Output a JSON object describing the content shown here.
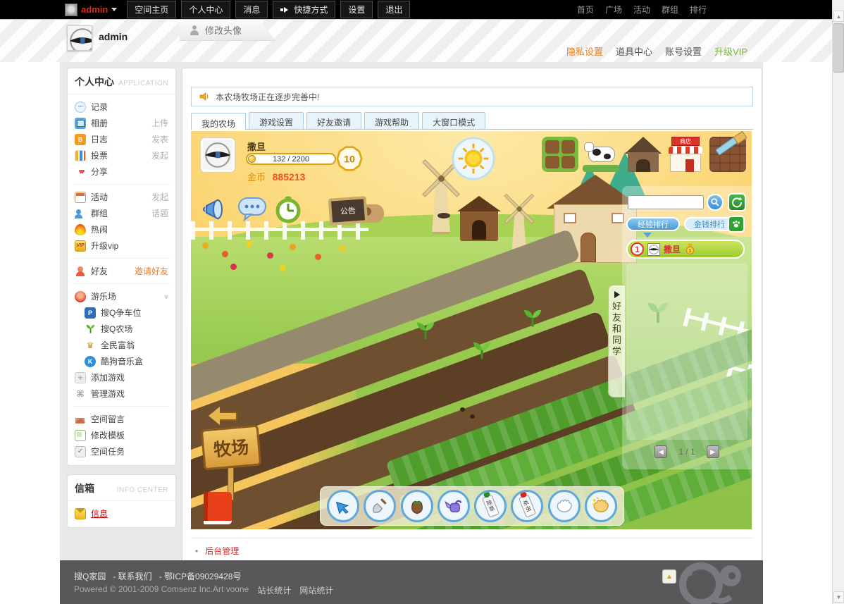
{
  "topbar": {
    "user": "admin",
    "menu": [
      "空间主页",
      "个人中心",
      "消息",
      "快捷方式",
      "设置",
      "退出"
    ],
    "right_links": [
      "首页",
      "广场",
      "活动",
      "群组",
      "排行"
    ]
  },
  "header": {
    "username": "admin",
    "edit_avatar": "修改头像",
    "links": [
      "隐私设置",
      "道具中心",
      "账号设置",
      "升级VIP"
    ]
  },
  "sidebar": {
    "profile": {
      "title": "个人中心",
      "subtitle": "APPLICATION",
      "items": [
        {
          "label": "记录",
          "action": ""
        },
        {
          "label": "相册",
          "action": "上传"
        },
        {
          "label": "日志",
          "action": "发表",
          "badge": "B"
        },
        {
          "label": "投票",
          "action": "发起"
        },
        {
          "label": "分享",
          "action": ""
        },
        {
          "label": "活动",
          "action": "发起"
        },
        {
          "label": "群组",
          "action": "话题"
        },
        {
          "label": "热闹",
          "action": ""
        },
        {
          "label": "升级vip",
          "action": "",
          "badge": "VIP"
        },
        {
          "label": "好友",
          "action": "邀请好友"
        },
        {
          "label": "游乐场",
          "action": ""
        },
        {
          "label": "搜Q争车位",
          "action": "",
          "badge": "P"
        },
        {
          "label": "搜Q农场",
          "action": ""
        },
        {
          "label": "全民富翁",
          "action": ""
        },
        {
          "label": "酷狗音乐盒",
          "action": "",
          "badge": "K"
        },
        {
          "label": "添加游戏",
          "action": ""
        },
        {
          "label": "管理游戏",
          "action": ""
        },
        {
          "label": "空间留言",
          "action": ""
        },
        {
          "label": "修改模板",
          "action": ""
        },
        {
          "label": "空间任务",
          "action": ""
        }
      ]
    },
    "inbox": {
      "title": "信箱",
      "subtitle": "INFO CENTER",
      "item": "信息"
    }
  },
  "main": {
    "announcement": "本农场牧场正在逐步完善中!",
    "tabs": [
      "我的农场",
      "游戏设置",
      "好友邀请",
      "游戏帮助",
      "大窗口模式"
    ],
    "admin_link": "后台管理"
  },
  "game": {
    "player": {
      "name": "撒旦",
      "xp": "132 / 2200",
      "level": "10",
      "coin_label": "金币",
      "coins": "885213"
    },
    "board": "公告",
    "shop_sign": "商店",
    "sign": "牧场",
    "friends_tab": "好友和同学",
    "rank": {
      "exp_tab": "经验排行",
      "money_tab": "金钱排行",
      "first_num": "1",
      "first_name": "撒旦",
      "medal": "1",
      "page": "1 / 1"
    },
    "tools": {
      "weed": "除草",
      "pest": "杀虫"
    }
  },
  "footer": {
    "site": "搜Q家园",
    "contact": "- 联系我们",
    "icp": "- 鄂ICP备09029428号",
    "powered": "Powered © 2001-2009 Comsenz Inc.Art voone",
    "stat1": "站长统计",
    "stat2": "网站统计"
  },
  "colors": {
    "admin_red": "#e8250c",
    "accent_orange": "#e87f1e",
    "link_green": "#7cb33f",
    "rank_green": "#9ccb30",
    "sky_orange": "#f6b93e",
    "footer_gray": "#58585a"
  }
}
